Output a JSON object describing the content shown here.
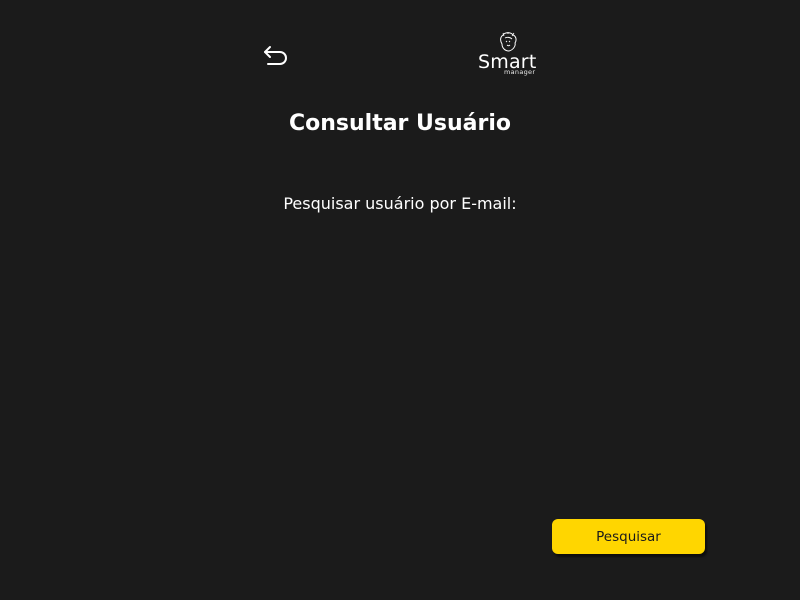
{
  "header": {
    "back_icon": "back-arrow-icon",
    "logo": {
      "word": "Smart",
      "sub": "manager",
      "icon": "lion-head-icon"
    }
  },
  "main": {
    "title": "Consultar Usuário",
    "search_label": "Pesquisar usuário por E-mail:"
  },
  "actions": {
    "search_button_label": "Pesquisar"
  },
  "colors": {
    "background": "#1b1b1b",
    "accent": "#ffd600",
    "text": "#ffffff"
  }
}
